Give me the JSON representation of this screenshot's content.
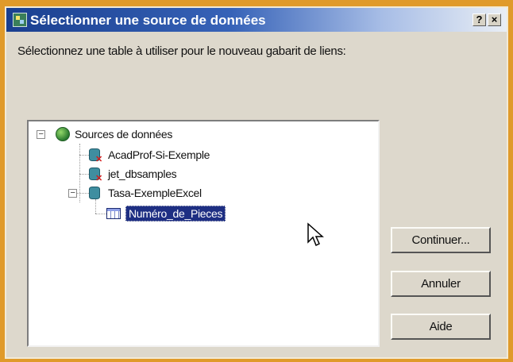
{
  "window": {
    "title": "Sélectionner une source de données",
    "help_label": "?",
    "close_label": "×"
  },
  "prompt": "Sélectionnez une table à utiliser pour le nouveau gabarit de liens:",
  "tree": {
    "root": "Sources de données",
    "items": [
      {
        "label": "AcadProf-Si-Exemple",
        "icon": "database-error-icon"
      },
      {
        "label": "jet_dbsamples",
        "icon": "database-error-icon"
      },
      {
        "label": "Tasa-ExempleExcel",
        "icon": "database-icon"
      }
    ],
    "child": {
      "label": "Numéro_de_Pieces",
      "icon": "table-icon",
      "selected": true
    }
  },
  "buttons": {
    "continue": "Continuer...",
    "cancel": "Annuler",
    "help": "Aide"
  }
}
